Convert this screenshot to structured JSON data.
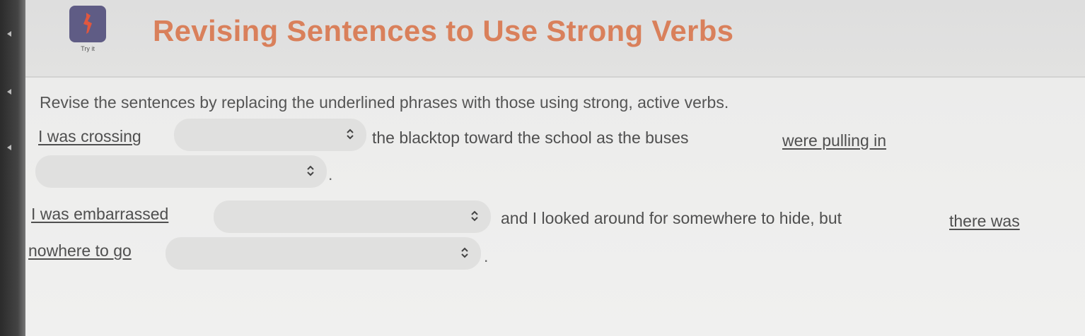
{
  "header": {
    "title": "Revising Sentences to Use Strong Verbs",
    "icon_label": "Try it"
  },
  "instructions": "Revise the sentences by replacing the underlined phrases with those using strong, active verbs.",
  "sentence1": {
    "phrase1": "I was crossing",
    "middle": "the blacktop toward the school as the buses",
    "phrase2": "were pulling in",
    "end": "."
  },
  "sentence2": {
    "phrase1": "I was embarrassed",
    "middle": "and I looked around for somewhere to hide, but",
    "phrase2_line1": "there was",
    "phrase2_line2": "nowhere to go",
    "end": "."
  },
  "dropdowns": [
    {
      "selected": ""
    },
    {
      "selected": ""
    },
    {
      "selected": ""
    },
    {
      "selected": ""
    }
  ],
  "icons": [
    "app-logo-icon",
    "chevron-updown-icon"
  ]
}
